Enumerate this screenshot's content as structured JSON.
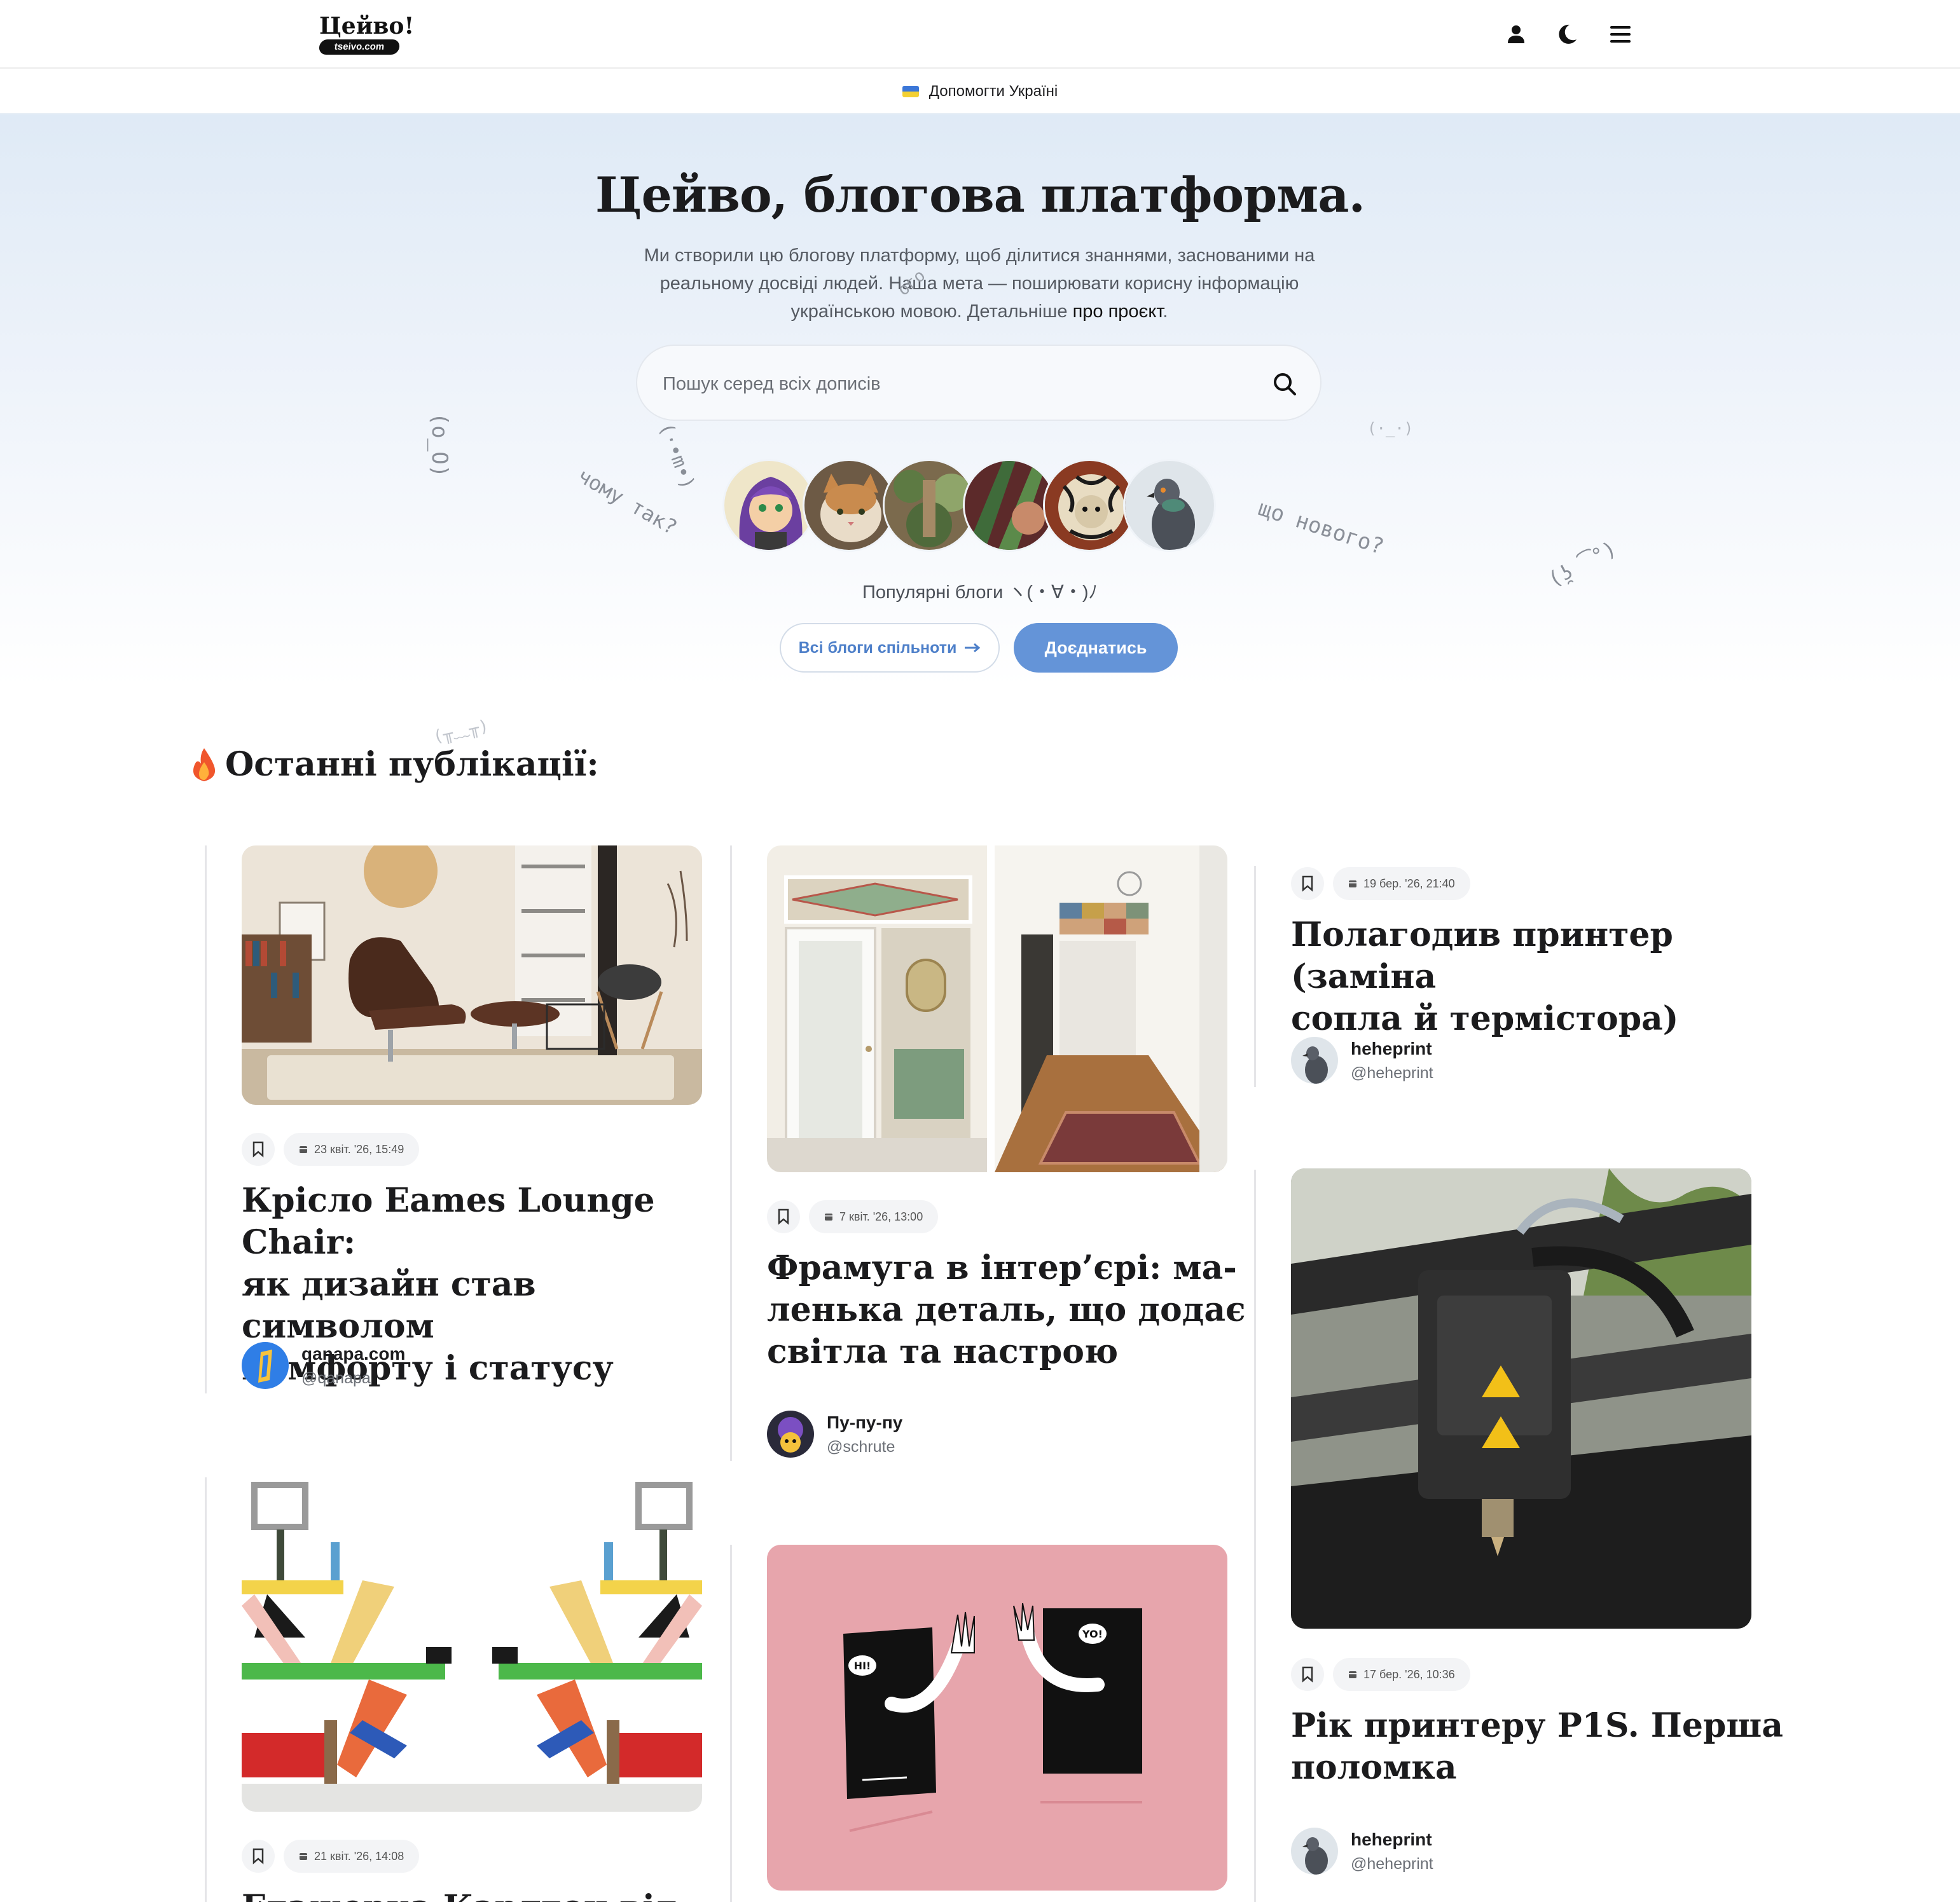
{
  "header": {
    "logo_title": "Цейво!",
    "logo_domain": "tseivo.com"
  },
  "ukraine_banner": {
    "label": "Допомогти Україні"
  },
  "hero": {
    "title": "Цейво, блогова платформа.",
    "desc_line1": "Ми створили цю блогову платформу, щоб ділитися знаннями, заснованими на",
    "desc_line2": "реальному досвіді людей. Наша мета — поширювати корисну інформацію",
    "desc_line3": "українською мовою. Детальніше ",
    "desc_link": "про проєкт",
    "desc_end": ".",
    "search_placeholder": "Пошук серед всіх дописів",
    "popular_label": "Популярні блоги ヽ(・∀・)ﾉ",
    "all_blogs_button": "Всі блоги спільноти",
    "join_button": "Доєднатись",
    "kaomoji": [
      "(o_O)",
      "(·•m•)",
      "чому так?",
      "що нового?",
      "(ʖ̯ ͡°)",
      "(╥﹏╥)",
      "ого",
      "(·_·)"
    ]
  },
  "latest": {
    "title": "Останні публікації:",
    "posts": [
      {
        "date": "23 квіт. '26, 15:49",
        "title_lines": [
          "Крісло Eames Lounge Chair:",
          "як дизайн став символом",
          "комфорту і статусу"
        ],
        "author": "qanapa.com",
        "handle": "@qanapa"
      },
      {
        "date": "7 квіт. '26, 13:00",
        "title_lines": [
          "Фрамуга в інтер’єрі: ма-",
          "ленька деталь, що додає",
          "світла та настрою"
        ],
        "author": "Пу-пу-пу",
        "handle": "@schrute"
      },
      {
        "date": "19 бер. '26, 21:40",
        "title_lines": [
          "Полагодив принтер (заміна",
          "сопла й термістора)"
        ],
        "author": "heheprint",
        "handle": "@heheprint"
      },
      {
        "date": "17 бер. '26, 10:36",
        "title_lines": [
          "Рік принтеру P1S. Перша",
          "поломка"
        ],
        "author": "heheprint",
        "handle": "@heheprint"
      },
      {
        "date": "21 квіт. '26, 14:08",
        "title_lines": [
          "Етажерка Карлтон від Етторе"
        ],
        "author": "",
        "handle": ""
      }
    ],
    "comic_bubbles": [
      "HI!",
      "YO!"
    ]
  }
}
